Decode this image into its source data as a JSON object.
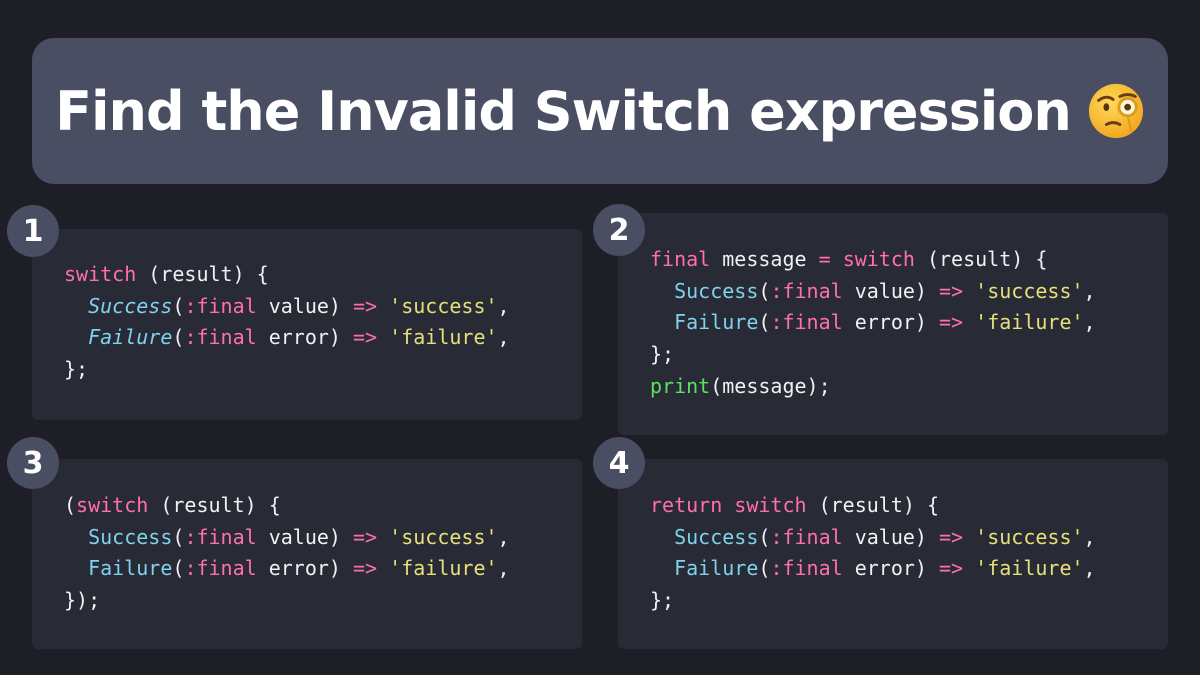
{
  "header": {
    "title": "Find the Invalid Switch expression",
    "emoji_icon": "face-with-monocle-icon"
  },
  "colors": {
    "background": "#1e1f26",
    "card": "#4a4e63",
    "panel": "#282a35",
    "keyword": "#ff6fb0",
    "type": "#7fd3ec",
    "string": "#e6e07a",
    "function": "#5ee060",
    "text": "#f1f1f1"
  },
  "options": [
    {
      "number": "1",
      "lines": [
        [
          {
            "t": "switch",
            "c": "kw"
          },
          {
            "t": " (result) {",
            "c": "pl"
          }
        ],
        [
          {
            "t": "  ",
            "c": "pl"
          },
          {
            "t": "Success",
            "c": "ty-it"
          },
          {
            "t": "(",
            "c": "pl"
          },
          {
            "t": ":final",
            "c": "kw"
          },
          {
            "t": " value) ",
            "c": "pl"
          },
          {
            "t": "=>",
            "c": "op"
          },
          {
            "t": " ",
            "c": "pl"
          },
          {
            "t": "'success'",
            "c": "str"
          },
          {
            "t": ",",
            "c": "pl"
          }
        ],
        [
          {
            "t": "  ",
            "c": "pl"
          },
          {
            "t": "Failure",
            "c": "ty-it"
          },
          {
            "t": "(",
            "c": "pl"
          },
          {
            "t": ":final",
            "c": "kw"
          },
          {
            "t": " error) ",
            "c": "pl"
          },
          {
            "t": "=>",
            "c": "op"
          },
          {
            "t": " ",
            "c": "pl"
          },
          {
            "t": "'failure'",
            "c": "str"
          },
          {
            "t": ",",
            "c": "pl"
          }
        ],
        [
          {
            "t": "};",
            "c": "pl"
          }
        ]
      ]
    },
    {
      "number": "2",
      "lines": [
        [
          {
            "t": "final",
            "c": "kw"
          },
          {
            "t": " message ",
            "c": "pl"
          },
          {
            "t": "=",
            "c": "op"
          },
          {
            "t": " ",
            "c": "pl"
          },
          {
            "t": "switch",
            "c": "kw"
          },
          {
            "t": " (result) {",
            "c": "pl"
          }
        ],
        [
          {
            "t": "  ",
            "c": "pl"
          },
          {
            "t": "Success",
            "c": "ty"
          },
          {
            "t": "(",
            "c": "pl"
          },
          {
            "t": ":final",
            "c": "kw"
          },
          {
            "t": " value) ",
            "c": "pl"
          },
          {
            "t": "=>",
            "c": "op"
          },
          {
            "t": " ",
            "c": "pl"
          },
          {
            "t": "'success'",
            "c": "str"
          },
          {
            "t": ",",
            "c": "pl"
          }
        ],
        [
          {
            "t": "  ",
            "c": "pl"
          },
          {
            "t": "Failure",
            "c": "ty"
          },
          {
            "t": "(",
            "c": "pl"
          },
          {
            "t": ":final",
            "c": "kw"
          },
          {
            "t": " error) ",
            "c": "pl"
          },
          {
            "t": "=>",
            "c": "op"
          },
          {
            "t": " ",
            "c": "pl"
          },
          {
            "t": "'failure'",
            "c": "str"
          },
          {
            "t": ",",
            "c": "pl"
          }
        ],
        [
          {
            "t": "};",
            "c": "pl"
          }
        ],
        [
          {
            "t": "print",
            "c": "fn"
          },
          {
            "t": "(message);",
            "c": "pl"
          }
        ]
      ]
    },
    {
      "number": "3",
      "lines": [
        [
          {
            "t": "(",
            "c": "pl"
          },
          {
            "t": "switch",
            "c": "kw"
          },
          {
            "t": " (result) {",
            "c": "pl"
          }
        ],
        [
          {
            "t": "  ",
            "c": "pl"
          },
          {
            "t": "Success",
            "c": "ty"
          },
          {
            "t": "(",
            "c": "pl"
          },
          {
            "t": ":final",
            "c": "kw"
          },
          {
            "t": " value) ",
            "c": "pl"
          },
          {
            "t": "=>",
            "c": "op"
          },
          {
            "t": " ",
            "c": "pl"
          },
          {
            "t": "'success'",
            "c": "str"
          },
          {
            "t": ",",
            "c": "pl"
          }
        ],
        [
          {
            "t": "  ",
            "c": "pl"
          },
          {
            "t": "Failure",
            "c": "ty"
          },
          {
            "t": "(",
            "c": "pl"
          },
          {
            "t": ":final",
            "c": "kw"
          },
          {
            "t": " error) ",
            "c": "pl"
          },
          {
            "t": "=>",
            "c": "op"
          },
          {
            "t": " ",
            "c": "pl"
          },
          {
            "t": "'failure'",
            "c": "str"
          },
          {
            "t": ",",
            "c": "pl"
          }
        ],
        [
          {
            "t": "});",
            "c": "pl"
          }
        ]
      ]
    },
    {
      "number": "4",
      "lines": [
        [
          {
            "t": "return",
            "c": "kw"
          },
          {
            "t": " ",
            "c": "pl"
          },
          {
            "t": "switch",
            "c": "kw"
          },
          {
            "t": " (result) {",
            "c": "pl"
          }
        ],
        [
          {
            "t": "  ",
            "c": "pl"
          },
          {
            "t": "Success",
            "c": "ty"
          },
          {
            "t": "(",
            "c": "pl"
          },
          {
            "t": ":final",
            "c": "kw"
          },
          {
            "t": " value) ",
            "c": "pl"
          },
          {
            "t": "=>",
            "c": "op"
          },
          {
            "t": " ",
            "c": "pl"
          },
          {
            "t": "'success'",
            "c": "str"
          },
          {
            "t": ",",
            "c": "pl"
          }
        ],
        [
          {
            "t": "  ",
            "c": "pl"
          },
          {
            "t": "Failure",
            "c": "ty"
          },
          {
            "t": "(",
            "c": "pl"
          },
          {
            "t": ":final",
            "c": "kw"
          },
          {
            "t": " error) ",
            "c": "pl"
          },
          {
            "t": "=>",
            "c": "op"
          },
          {
            "t": " ",
            "c": "pl"
          },
          {
            "t": "'failure'",
            "c": "str"
          },
          {
            "t": ",",
            "c": "pl"
          }
        ],
        [
          {
            "t": "};",
            "c": "pl"
          }
        ]
      ]
    }
  ]
}
